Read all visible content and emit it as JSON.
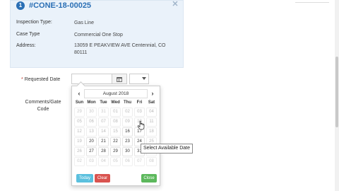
{
  "card": {
    "badge": "1",
    "case_id": "#CONE-18-00025",
    "fields": [
      {
        "label": "Inspection Type:",
        "value": "Gas Line"
      },
      {
        "label": "Case Type",
        "value": "Commercial One Stop"
      },
      {
        "label": "Address:",
        "value_line1": "13059 E PEAKVIEW AVE  Centennial, CO",
        "value_line2": "80111"
      }
    ]
  },
  "form": {
    "requested_date_star": "*",
    "requested_date_label": "Requested Date",
    "comments_label_line1": "Comments/Gate",
    "comments_label_line2": "Code"
  },
  "datepicker": {
    "prev": "‹",
    "next": "›",
    "month": "August 2018",
    "dow": [
      "Sun",
      "Mon",
      "Tue",
      "Wed",
      "Thu",
      "Fri",
      "Sat"
    ],
    "weeks": [
      [
        {
          "d": "29",
          "s": "muted"
        },
        {
          "d": "30",
          "s": "muted"
        },
        {
          "d": "31",
          "s": "muted"
        },
        {
          "d": "01",
          "s": "disabled"
        },
        {
          "d": "02",
          "s": "disabled"
        },
        {
          "d": "03",
          "s": "disabled"
        },
        {
          "d": "04",
          "s": "disabled"
        }
      ],
      [
        {
          "d": "05",
          "s": "disabled"
        },
        {
          "d": "06",
          "s": "disabled"
        },
        {
          "d": "07",
          "s": "disabled"
        },
        {
          "d": "08",
          "s": "disabled"
        },
        {
          "d": "09",
          "s": "disabled"
        },
        {
          "d": "10",
          "s": "disabled"
        },
        {
          "d": "11",
          "s": "disabled"
        }
      ],
      [
        {
          "d": "12",
          "s": "disabled"
        },
        {
          "d": "13",
          "s": "disabled"
        },
        {
          "d": "14",
          "s": "disabled"
        },
        {
          "d": "15",
          "s": "disabled"
        },
        {
          "d": "16",
          "s": "avail"
        },
        {
          "d": "17",
          "s": "avail"
        },
        {
          "d": "18",
          "s": "disabled"
        }
      ],
      [
        {
          "d": "19",
          "s": "disabled"
        },
        {
          "d": "20",
          "s": "avail"
        },
        {
          "d": "21",
          "s": "avail"
        },
        {
          "d": "22",
          "s": "avail"
        },
        {
          "d": "23",
          "s": "avail"
        },
        {
          "d": "24",
          "s": "avail"
        },
        {
          "d": "25",
          "s": "disabled"
        }
      ],
      [
        {
          "d": "26",
          "s": "disabled"
        },
        {
          "d": "27",
          "s": "avail"
        },
        {
          "d": "28",
          "s": "avail"
        },
        {
          "d": "29",
          "s": "avail"
        },
        {
          "d": "30",
          "s": "avail"
        },
        {
          "d": "31",
          "s": "avail"
        },
        {
          "d": "01",
          "s": "muted"
        }
      ],
      [
        {
          "d": "02",
          "s": "muted"
        },
        {
          "d": "03",
          "s": "muted"
        },
        {
          "d": "04",
          "s": "muted"
        },
        {
          "d": "05",
          "s": "muted"
        },
        {
          "d": "06",
          "s": "muted"
        },
        {
          "d": "07",
          "s": "muted"
        },
        {
          "d": "08",
          "s": "muted"
        }
      ]
    ],
    "today_label": "Today",
    "clear_label": "Clear",
    "close_label": "Close"
  },
  "tooltip": "Select Available Date",
  "colors": {
    "accent": "#2a6fb5",
    "today_btn": "#5bc0de",
    "clear_btn": "#d9534f",
    "close_btn": "#5cb85c",
    "card_bg": "#eaf2fa"
  }
}
